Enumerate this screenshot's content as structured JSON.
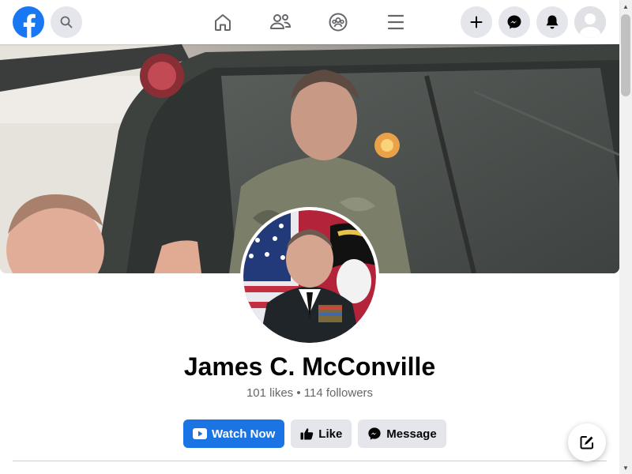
{
  "profile": {
    "name": "James C. McConville",
    "stats": "101 likes • 114 followers"
  },
  "actions": {
    "watch_label": "Watch Now",
    "like_label": "Like",
    "message_label": "Message"
  },
  "nav": {
    "items": [
      "home-icon",
      "friends-icon",
      "groups-icon",
      "menu-icon"
    ]
  },
  "colors": {
    "brand": "#1877F2",
    "primary_button": "#1B74E4",
    "secondary_button": "#E4E6EB",
    "text": "#050505",
    "muted_text": "#65676B"
  }
}
